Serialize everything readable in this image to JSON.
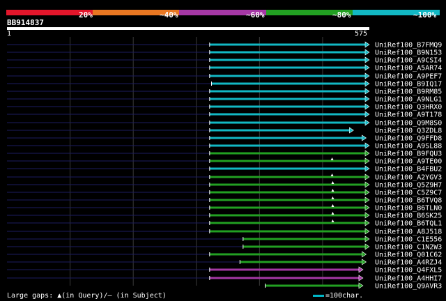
{
  "legend": {
    "labels": [
      "20%",
      "~40%",
      "~60%",
      "~80%",
      "~100%"
    ],
    "colors": [
      "#e3162b",
      "#e87722",
      "#a538a5",
      "#22a022",
      "#12b8c4"
    ]
  },
  "query": {
    "id": "BB914837",
    "start": "1",
    "end": "575",
    "length": 575
  },
  "hits": [
    {
      "label": "UniRef100_B7FMQ9",
      "color": "cyan",
      "q_start": 322,
      "q_end": 575,
      "pre_start": 1,
      "arrow": true,
      "marker": null
    },
    {
      "label": "UniRef100_B9N153",
      "color": "cyan",
      "q_start": 322,
      "q_end": 575,
      "pre_start": 1,
      "arrow": true,
      "marker": null
    },
    {
      "label": "UniRef100_A9CSI4",
      "color": "cyan",
      "q_start": 322,
      "q_end": 575,
      "pre_start": 1,
      "arrow": true,
      "marker": null
    },
    {
      "label": "UniRef100_A5AR74",
      "color": "cyan",
      "q_start": 322,
      "q_end": 575,
      "pre_start": 1,
      "arrow": true,
      "marker": null
    },
    {
      "label": "UniRef100_A9PEF7",
      "color": "cyan",
      "q_start": 322,
      "q_end": 575,
      "pre_start": 1,
      "arrow": true,
      "marker": null
    },
    {
      "label": "UniRef100_B9IQ17",
      "color": "cyan",
      "q_start": 325,
      "q_end": 575,
      "pre_start": 1,
      "arrow": true,
      "marker": null
    },
    {
      "label": "UniRef100_B9RM85",
      "color": "cyan",
      "q_start": 322,
      "q_end": 575,
      "pre_start": 1,
      "arrow": true,
      "marker": null
    },
    {
      "label": "UniRef100_A9NLG1",
      "color": "cyan",
      "q_start": 322,
      "q_end": 575,
      "pre_start": 1,
      "arrow": true,
      "marker": null
    },
    {
      "label": "UniRef100_Q3HRX0",
      "color": "cyan",
      "q_start": 322,
      "q_end": 575,
      "pre_start": 1,
      "arrow": true,
      "marker": null
    },
    {
      "label": "UniRef100_A9T178",
      "color": "cyan",
      "q_start": 322,
      "q_end": 575,
      "pre_start": 1,
      "arrow": true,
      "marker": null
    },
    {
      "label": "UniRef100_Q9M8S0",
      "color": "cyan",
      "q_start": 322,
      "q_end": 575,
      "pre_start": 1,
      "arrow": true,
      "marker": null
    },
    {
      "label": "UniRef100_Q3ZDL8",
      "color": "cyan",
      "q_start": 322,
      "q_end": 550,
      "pre_start": 1,
      "arrow": true,
      "marker": null
    },
    {
      "label": "UniRef100_Q9FFD8",
      "color": "cyan",
      "q_start": 322,
      "q_end": 570,
      "pre_start": 1,
      "arrow": true,
      "marker": null
    },
    {
      "label": "UniRef100_A9SL88",
      "color": "cyan",
      "q_start": 322,
      "q_end": 575,
      "pre_start": 1,
      "arrow": true,
      "marker": null
    },
    {
      "label": "UniRef100_B9FQU3",
      "color": "green",
      "q_start": 322,
      "q_end": 575,
      "pre_start": 1,
      "arrow": true,
      "marker": null
    },
    {
      "label": "UniRef100_A9TE00",
      "color": "green",
      "q_start": 322,
      "q_end": 575,
      "pre_start": 1,
      "arrow": true,
      "marker": 516
    },
    {
      "label": "UniRef100_B4FBU2",
      "color": "cyan",
      "q_start": 322,
      "q_end": 575,
      "pre_start": 1,
      "arrow": true,
      "marker": null
    },
    {
      "label": "UniRef100_A2YGV3",
      "color": "green",
      "q_start": 322,
      "q_end": 575,
      "pre_start": 1,
      "arrow": true,
      "marker": 516
    },
    {
      "label": "UniRef100_Q5Z9H7",
      "color": "green",
      "q_start": 322,
      "q_end": 575,
      "pre_start": 1,
      "arrow": true,
      "marker": 517
    },
    {
      "label": "UniRef100_C5Z9C7",
      "color": "green",
      "q_start": 322,
      "q_end": 575,
      "pre_start": 1,
      "arrow": true,
      "marker": 517
    },
    {
      "label": "UniRef100_B6TVQ8",
      "color": "green",
      "q_start": 322,
      "q_end": 575,
      "pre_start": 1,
      "arrow": true,
      "marker": 517
    },
    {
      "label": "UniRef100_B6TLN0",
      "color": "green",
      "q_start": 322,
      "q_end": 575,
      "pre_start": 1,
      "arrow": true,
      "marker": 517
    },
    {
      "label": "UniRef100_B6SK25",
      "color": "green",
      "q_start": 322,
      "q_end": 575,
      "pre_start": 1,
      "arrow": true,
      "marker": 517
    },
    {
      "label": "UniRef100_B6TQL1",
      "color": "green",
      "q_start": 322,
      "q_end": 575,
      "pre_start": 1,
      "arrow": true,
      "marker": 517
    },
    {
      "label": "UniRef100_A8J518",
      "color": "green",
      "q_start": 322,
      "q_end": 575,
      "pre_start": 1,
      "arrow": true,
      "marker": null
    },
    {
      "label": "UniRef100_C1E556",
      "color": "green",
      "q_start": 375,
      "q_end": 575,
      "pre_start": 1,
      "arrow": true,
      "marker": null
    },
    {
      "label": "UniRef100_C1N2W3",
      "color": "green",
      "q_start": 375,
      "q_end": 575,
      "pre_start": 1,
      "arrow": true,
      "marker": null
    },
    {
      "label": "UniRef100_Q01C62",
      "color": "green",
      "q_start": 322,
      "q_end": 570,
      "pre_start": 1,
      "arrow": true,
      "marker": null
    },
    {
      "label": "UniRef100_A4RZJ4",
      "color": "green",
      "q_start": 370,
      "q_end": 570,
      "pre_start": 1,
      "arrow": true,
      "marker": null
    },
    {
      "label": "UniRef100_Q4FXL5",
      "color": "magenta",
      "q_start": 322,
      "q_end": 565,
      "pre_start": 1,
      "arrow": true,
      "marker": null
    },
    {
      "label": "UniRef100_A4HHI7",
      "color": "magenta",
      "q_start": 322,
      "q_end": 565,
      "pre_start": 1,
      "arrow": true,
      "marker": null
    },
    {
      "label": "UniRef100_Q9AVR3",
      "color": "green",
      "q_start": 410,
      "q_end": 565,
      "pre_start": null,
      "arrow": true,
      "marker": null
    }
  ],
  "colors": {
    "cyan": "#12b8c4",
    "green": "#22a022",
    "magenta": "#a538a5",
    "pre_line": "#1c1c60",
    "grid": "#3a3a3a"
  },
  "footer": {
    "gaps_text": "Large gaps: ▲(in Query)/– (in Subject)",
    "scale_text": "=100char."
  }
}
